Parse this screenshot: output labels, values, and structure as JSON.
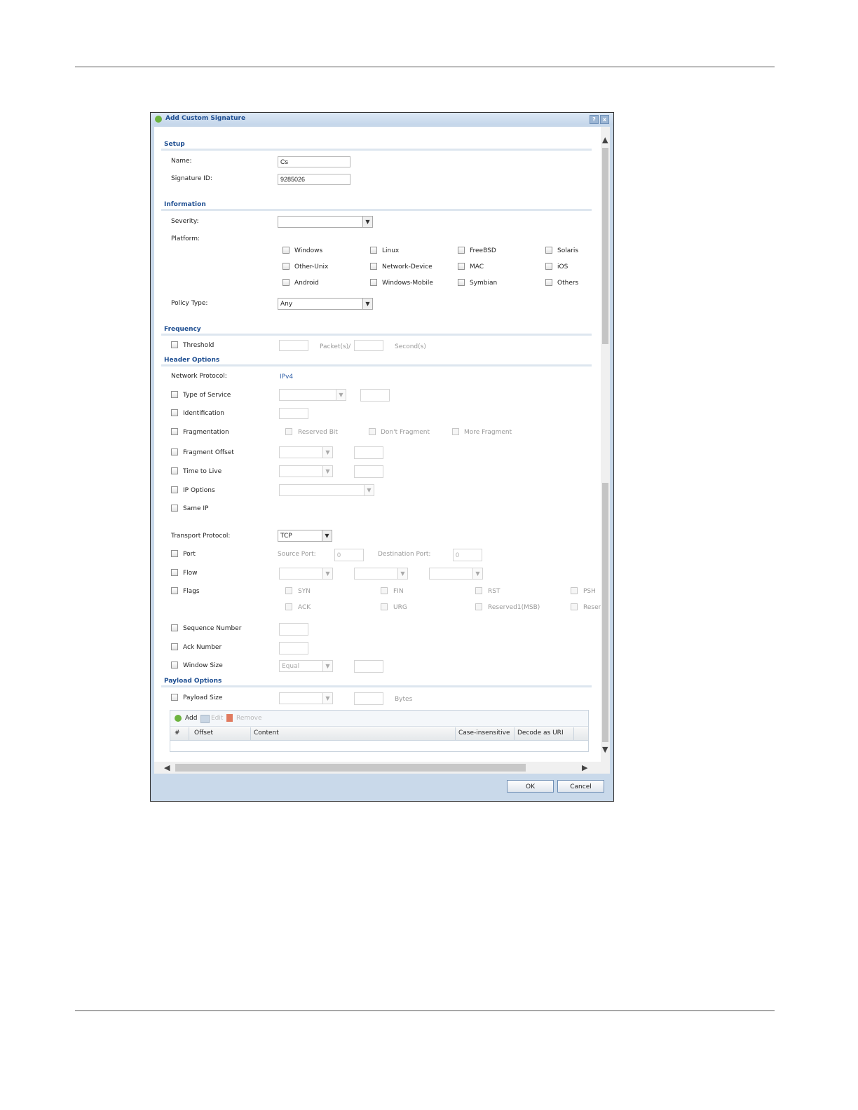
{
  "dialog": {
    "title": "Add Custom Signature",
    "help_label": "?",
    "close_label": "x"
  },
  "setup": {
    "heading": "Setup",
    "name_label": "Name:",
    "name_value": "Cs",
    "sigid_label": "Signature ID:",
    "sigid_value": "9285026"
  },
  "information": {
    "heading": "Information",
    "severity_label": "Severity:",
    "severity_value": "",
    "platform_label": "Platform:",
    "platforms": [
      "Windows",
      "Linux",
      "FreeBSD",
      "Solaris",
      "Other-Unix",
      "Network-Device",
      "MAC",
      "iOS",
      "Android",
      "Windows-Mobile",
      "Symbian",
      "Others"
    ],
    "policy_label": "Policy Type:",
    "policy_value": "Any"
  },
  "frequency": {
    "heading": "Frequency",
    "threshold_label": "Threshold",
    "packets_label": "Packet(s)/",
    "seconds_label": "Second(s)"
  },
  "header": {
    "heading": "Header Options",
    "network_protocol_label": "Network Protocol:",
    "network_protocol_value": "IPv4",
    "tos_label": "Type of Service",
    "identification_label": "Identification",
    "fragmentation_label": "Fragmentation",
    "reserved_bit_label": "Reserved Bit",
    "dont_fragment_label": "Don't Fragment",
    "more_fragment_label": "More Fragment",
    "fragment_offset_label": "Fragment Offset",
    "ttl_label": "Time to Live",
    "ip_options_label": "IP Options",
    "same_ip_label": "Same IP",
    "transport_label": "Transport Protocol:",
    "transport_value": "TCP",
    "port_label": "Port",
    "source_port_label": "Source Port:",
    "source_port_value": "0",
    "dest_port_label": "Destination Port:",
    "dest_port_value": "0",
    "flow_label": "Flow",
    "flags_label": "Flags",
    "flags": [
      "SYN",
      "FIN",
      "RST",
      "PSH",
      "ACK",
      "URG",
      "Reserved1(MSB)",
      "Reser"
    ],
    "seq_label": "Sequence Number",
    "ack_label": "Ack Number",
    "window_label": "Window Size",
    "window_value": "Equal"
  },
  "payload": {
    "heading": "Payload Options",
    "size_label": "Payload Size",
    "bytes_label": "Bytes",
    "add_label": "Add",
    "edit_label": "Edit",
    "remove_label": "Remove",
    "columns": [
      "#",
      "Offset",
      "Content",
      "Case-insensitive",
      "Decode as URI"
    ]
  },
  "footer": {
    "ok_label": "OK",
    "cancel_label": "Cancel"
  }
}
